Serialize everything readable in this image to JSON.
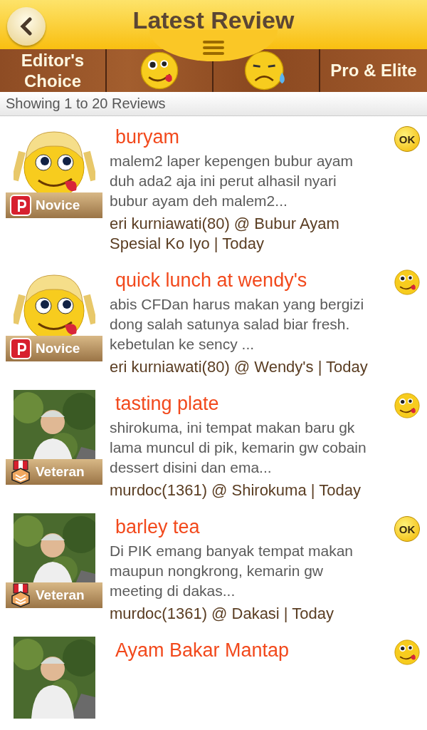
{
  "header": {
    "title": "Latest Review"
  },
  "tabs": [
    {
      "kind": "text",
      "label": "Editor's\nChoice"
    },
    {
      "kind": "yummy"
    },
    {
      "kind": "sad"
    },
    {
      "kind": "text",
      "label": "Pro & Elite"
    }
  ],
  "summary": "Showing 1 to 20 Reviews",
  "reviews": [
    {
      "avatar": {
        "kind": "cartoon"
      },
      "badge": {
        "kind": "novice",
        "label": "Novice"
      },
      "title": "buryam",
      "rating": {
        "kind": "ok",
        "label": "OK"
      },
      "body": "malem2 laper kepengen bubur ayam duh ada2 aja ini perut alhasil nyari bubur ayam deh malem2...",
      "meta": "eri kurniawati(80) @ Bubur Ayam Spesial Ko Iyo | Today"
    },
    {
      "avatar": {
        "kind": "cartoon"
      },
      "badge": {
        "kind": "novice",
        "label": "Novice"
      },
      "title": "quick lunch at wendy's",
      "rating": {
        "kind": "yummy"
      },
      "body": "abis CFDan harus makan yang bergizi dong salah satunya salad biar fresh. kebetulan ke sency ...",
      "meta": "eri kurniawati(80) @ Wendy's | Today"
    },
    {
      "badge": {
        "kind": "veteran",
        "label": "Veteran"
      },
      "title": "tasting plate",
      "rating": {
        "kind": "yummy"
      },
      "body": "shirokuma, ini tempat makan baru gk lama muncul di pik, kemarin gw cobain dessert disini dan ema...",
      "meta": "murdoc(1361) @ Shirokuma | Today"
    },
    {
      "badge": {
        "kind": "veteran",
        "label": "Veteran"
      },
      "title": "barley tea",
      "rating": {
        "kind": "ok",
        "label": "OK"
      },
      "body": "Di PIK emang banyak tempat makan maupun nongkrong, kemarin gw meeting di dakas...",
      "meta": "murdoc(1361) @ Dakasi | Today"
    },
    {
      "title": "Ayam Bakar Mantap",
      "rating": {
        "kind": "yummy"
      }
    }
  ]
}
